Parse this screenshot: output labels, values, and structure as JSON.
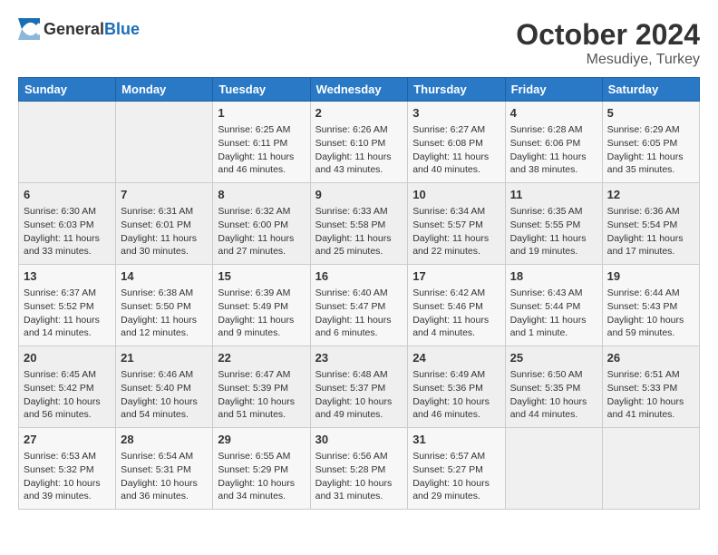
{
  "logo": {
    "text_general": "General",
    "text_blue": "Blue"
  },
  "title": {
    "month": "October 2024",
    "location": "Mesudiye, Turkey"
  },
  "days_of_week": [
    "Sunday",
    "Monday",
    "Tuesday",
    "Wednesday",
    "Thursday",
    "Friday",
    "Saturday"
  ],
  "weeks": [
    [
      {
        "day": "",
        "empty": true
      },
      {
        "day": "",
        "empty": true
      },
      {
        "day": "1",
        "sunrise": "6:25 AM",
        "sunset": "6:11 PM",
        "daylight": "11 hours and 46 minutes."
      },
      {
        "day": "2",
        "sunrise": "6:26 AM",
        "sunset": "6:10 PM",
        "daylight": "11 hours and 43 minutes."
      },
      {
        "day": "3",
        "sunrise": "6:27 AM",
        "sunset": "6:08 PM",
        "daylight": "11 hours and 40 minutes."
      },
      {
        "day": "4",
        "sunrise": "6:28 AM",
        "sunset": "6:06 PM",
        "daylight": "11 hours and 38 minutes."
      },
      {
        "day": "5",
        "sunrise": "6:29 AM",
        "sunset": "6:05 PM",
        "daylight": "11 hours and 35 minutes."
      }
    ],
    [
      {
        "day": "6",
        "sunrise": "6:30 AM",
        "sunset": "6:03 PM",
        "daylight": "11 hours and 33 minutes."
      },
      {
        "day": "7",
        "sunrise": "6:31 AM",
        "sunset": "6:01 PM",
        "daylight": "11 hours and 30 minutes."
      },
      {
        "day": "8",
        "sunrise": "6:32 AM",
        "sunset": "6:00 PM",
        "daylight": "11 hours and 27 minutes."
      },
      {
        "day": "9",
        "sunrise": "6:33 AM",
        "sunset": "5:58 PM",
        "daylight": "11 hours and 25 minutes."
      },
      {
        "day": "10",
        "sunrise": "6:34 AM",
        "sunset": "5:57 PM",
        "daylight": "11 hours and 22 minutes."
      },
      {
        "day": "11",
        "sunrise": "6:35 AM",
        "sunset": "5:55 PM",
        "daylight": "11 hours and 19 minutes."
      },
      {
        "day": "12",
        "sunrise": "6:36 AM",
        "sunset": "5:54 PM",
        "daylight": "11 hours and 17 minutes."
      }
    ],
    [
      {
        "day": "13",
        "sunrise": "6:37 AM",
        "sunset": "5:52 PM",
        "daylight": "11 hours and 14 minutes."
      },
      {
        "day": "14",
        "sunrise": "6:38 AM",
        "sunset": "5:50 PM",
        "daylight": "11 hours and 12 minutes."
      },
      {
        "day": "15",
        "sunrise": "6:39 AM",
        "sunset": "5:49 PM",
        "daylight": "11 hours and 9 minutes."
      },
      {
        "day": "16",
        "sunrise": "6:40 AM",
        "sunset": "5:47 PM",
        "daylight": "11 hours and 6 minutes."
      },
      {
        "day": "17",
        "sunrise": "6:42 AM",
        "sunset": "5:46 PM",
        "daylight": "11 hours and 4 minutes."
      },
      {
        "day": "18",
        "sunrise": "6:43 AM",
        "sunset": "5:44 PM",
        "daylight": "11 hours and 1 minute."
      },
      {
        "day": "19",
        "sunrise": "6:44 AM",
        "sunset": "5:43 PM",
        "daylight": "10 hours and 59 minutes."
      }
    ],
    [
      {
        "day": "20",
        "sunrise": "6:45 AM",
        "sunset": "5:42 PM",
        "daylight": "10 hours and 56 minutes."
      },
      {
        "day": "21",
        "sunrise": "6:46 AM",
        "sunset": "5:40 PM",
        "daylight": "10 hours and 54 minutes."
      },
      {
        "day": "22",
        "sunrise": "6:47 AM",
        "sunset": "5:39 PM",
        "daylight": "10 hours and 51 minutes."
      },
      {
        "day": "23",
        "sunrise": "6:48 AM",
        "sunset": "5:37 PM",
        "daylight": "10 hours and 49 minutes."
      },
      {
        "day": "24",
        "sunrise": "6:49 AM",
        "sunset": "5:36 PM",
        "daylight": "10 hours and 46 minutes."
      },
      {
        "day": "25",
        "sunrise": "6:50 AM",
        "sunset": "5:35 PM",
        "daylight": "10 hours and 44 minutes."
      },
      {
        "day": "26",
        "sunrise": "6:51 AM",
        "sunset": "5:33 PM",
        "daylight": "10 hours and 41 minutes."
      }
    ],
    [
      {
        "day": "27",
        "sunrise": "6:53 AM",
        "sunset": "5:32 PM",
        "daylight": "10 hours and 39 minutes."
      },
      {
        "day": "28",
        "sunrise": "6:54 AM",
        "sunset": "5:31 PM",
        "daylight": "10 hours and 36 minutes."
      },
      {
        "day": "29",
        "sunrise": "6:55 AM",
        "sunset": "5:29 PM",
        "daylight": "10 hours and 34 minutes."
      },
      {
        "day": "30",
        "sunrise": "6:56 AM",
        "sunset": "5:28 PM",
        "daylight": "10 hours and 31 minutes."
      },
      {
        "day": "31",
        "sunrise": "6:57 AM",
        "sunset": "5:27 PM",
        "daylight": "10 hours and 29 minutes."
      },
      {
        "day": "",
        "empty": true
      },
      {
        "day": "",
        "empty": true
      }
    ]
  ],
  "labels": {
    "sunrise": "Sunrise:",
    "sunset": "Sunset:",
    "daylight": "Daylight:"
  }
}
